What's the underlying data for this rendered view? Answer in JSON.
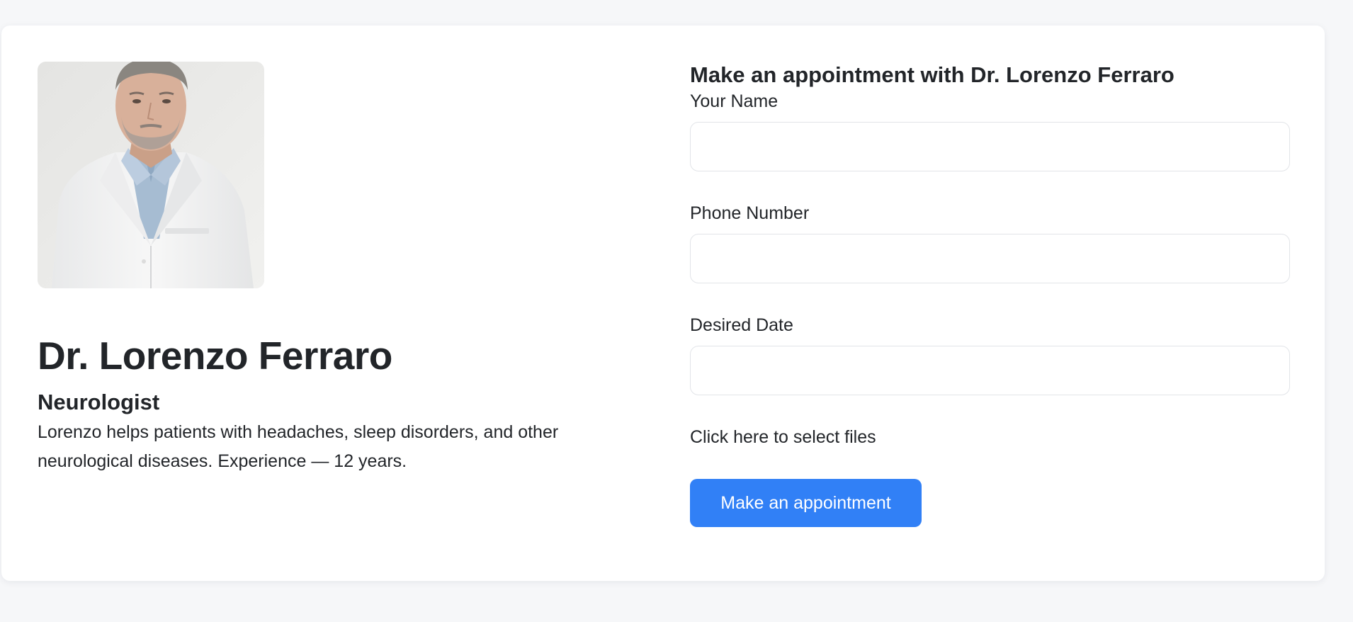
{
  "doctor": {
    "photo_alt": "Dr. Lorenzo Ferraro",
    "name": "Dr. Lorenzo Ferraro",
    "specialty": "Neurologist",
    "bio": "Lorenzo helps patients with headaches, sleep disorders, and other neurological diseases. Experience — 12 years."
  },
  "form": {
    "title": "Make an appointment with Dr. Lorenzo Ferraro",
    "fields": [
      {
        "label": "Your Name",
        "value": "",
        "placeholder": ""
      },
      {
        "label": "Phone Number",
        "value": "",
        "placeholder": ""
      },
      {
        "label": "Desired Date",
        "value": "",
        "placeholder": ""
      }
    ],
    "file_select_label": "Click here to select files",
    "submit_label": "Make an appointment"
  },
  "colors": {
    "page_background": "#f6f7f9",
    "card_background": "#ffffff",
    "text": "#222529",
    "accent": "#3180f6",
    "input_border": "#e2e4e8"
  }
}
